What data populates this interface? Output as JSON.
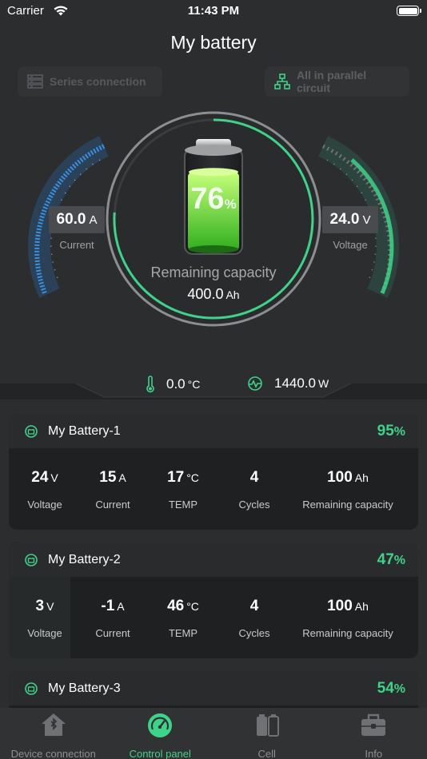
{
  "status_bar": {
    "carrier": "Carrier",
    "time": "11:43 PM"
  },
  "title": "My battery",
  "modes": {
    "series": "Series connection",
    "parallel": "All in parallel circuit"
  },
  "gauges": {
    "current": {
      "value": "60.0",
      "unit": "A",
      "label": "Current"
    },
    "voltage": {
      "value": "24.0",
      "unit": "V",
      "label": "Voltage"
    }
  },
  "battery": {
    "percent": "76",
    "percent_fraction": 0.76,
    "percent_sign": "%",
    "remaining_label": "Remaining capacity",
    "remaining_value": "400.0",
    "remaining_unit": "Ah"
  },
  "stats": {
    "temperature": {
      "value": "0.0",
      "unit": "°C"
    },
    "power": {
      "value": "1440.0",
      "unit": "W"
    }
  },
  "labels": {
    "voltage": "Voltage",
    "current": "Current",
    "temp": "TEMP",
    "cycles": "Cycles",
    "remaining": "Remaining capacity"
  },
  "packs": [
    {
      "name": "My Battery-1",
      "percent": "95",
      "percent_sign": "%",
      "voltage": "24",
      "voltage_unit": "V",
      "current": "15",
      "current_unit": "A",
      "temp": "17",
      "temp_unit": "°C",
      "cycles": "4",
      "capacity": "100",
      "capacity_unit": "Ah"
    },
    {
      "name": "My Battery-2",
      "percent": "47",
      "percent_sign": "%",
      "voltage": "3",
      "voltage_unit": "V",
      "current": "-1",
      "current_unit": "A",
      "temp": "46",
      "temp_unit": "°C",
      "cycles": "4",
      "capacity": "100",
      "capacity_unit": "Ah"
    },
    {
      "name": "My Battery-3",
      "percent": "54",
      "percent_sign": "%"
    }
  ],
  "tabs": [
    {
      "label": "Device connection",
      "icon": "home-bluetooth-icon",
      "active": false
    },
    {
      "label": "Control panel",
      "icon": "gauge-icon",
      "active": true
    },
    {
      "label": "Cell",
      "icon": "cell-icon",
      "active": false
    },
    {
      "label": "Info",
      "icon": "briefcase-icon",
      "active": false
    }
  ],
  "colors": {
    "accent": "#3fd28a",
    "current_blue": "#3a8fe0",
    "background": "#2c2d2f"
  }
}
